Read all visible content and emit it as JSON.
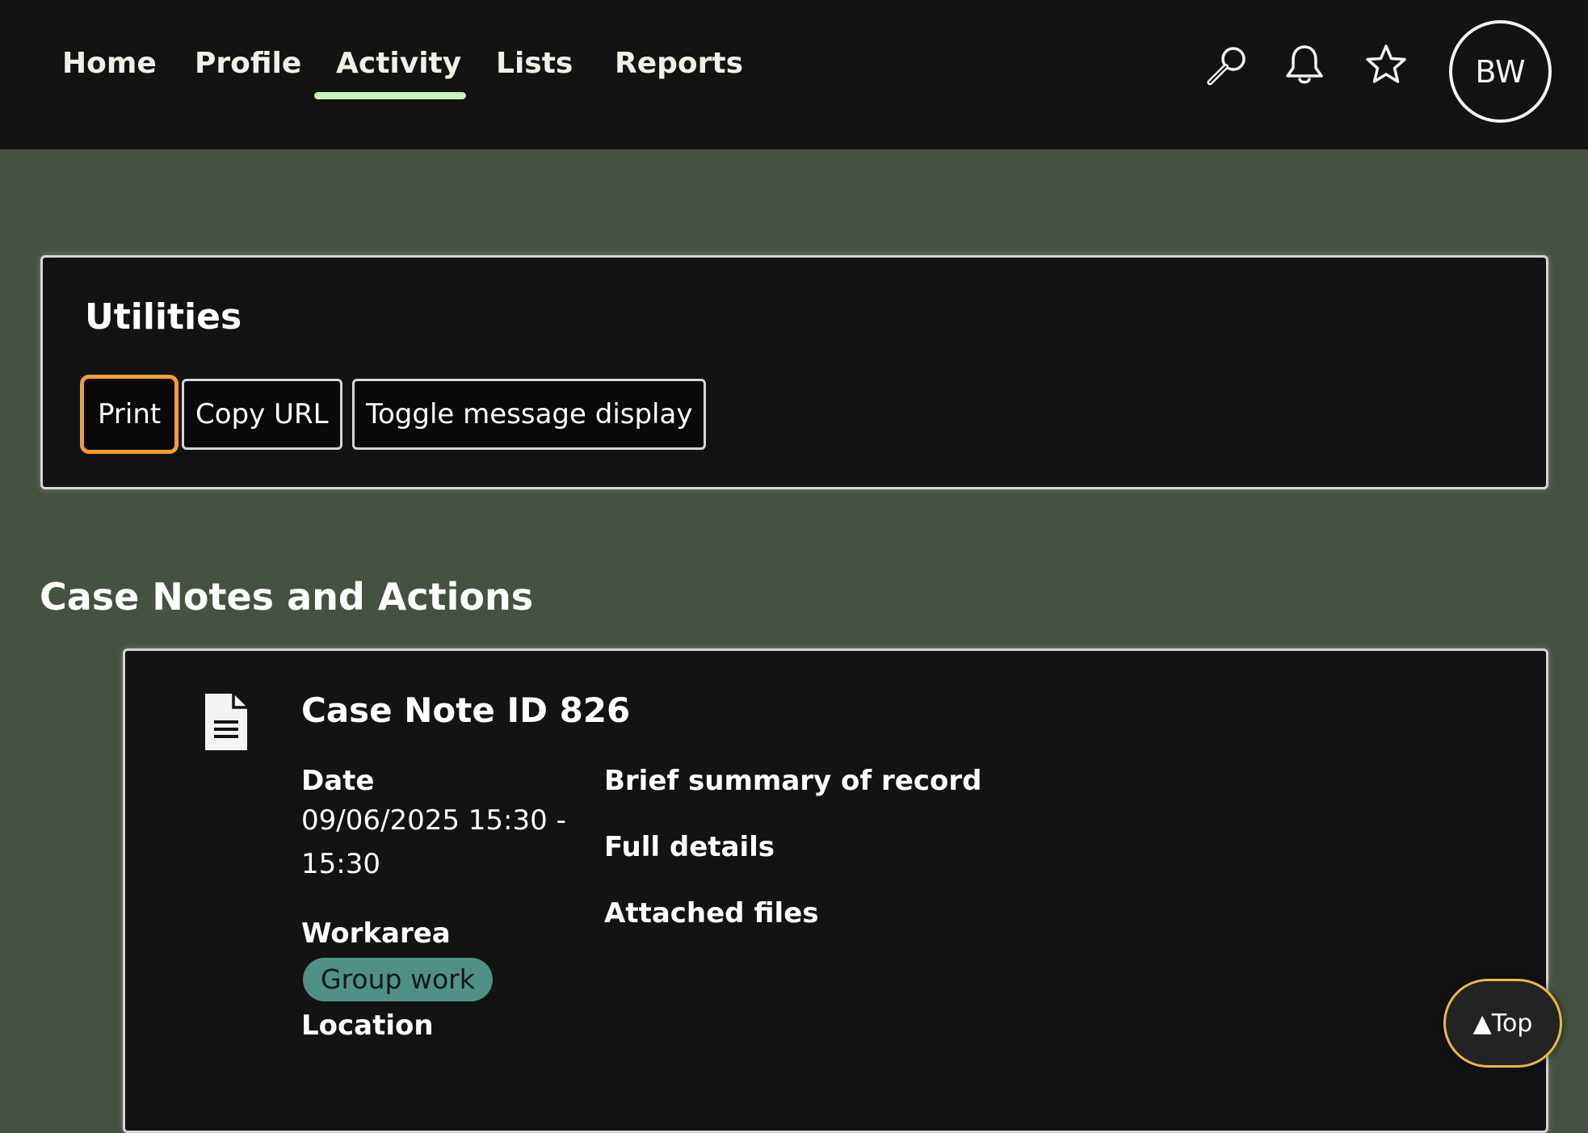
{
  "nav": {
    "items": [
      {
        "label": "Home"
      },
      {
        "label": "Profile"
      },
      {
        "label": "Activity",
        "active": true
      },
      {
        "label": "Lists"
      },
      {
        "label": "Reports"
      }
    ],
    "icons": [
      "search-icon",
      "bell-icon",
      "star-icon"
    ],
    "avatar_initials": "BW"
  },
  "utilities": {
    "title": "Utilities",
    "buttons": [
      {
        "label": "Print",
        "focused": true
      },
      {
        "label": "Copy URL"
      },
      {
        "label": "Toggle message display"
      }
    ]
  },
  "section": {
    "title": "Case Notes and Actions"
  },
  "case_note": {
    "icon": "document-icon",
    "title": "Case Note ID 826",
    "date_label": "Date",
    "date_value": "09/06/2025 15:30 - 15:30",
    "workarea_label": "Workarea",
    "workarea_tag": "Group work",
    "location_label": "Location",
    "summary_label": "Brief summary of record",
    "details_label": "Full details",
    "files_label": "Attached files"
  },
  "back_to_top": {
    "label": "▲Top"
  },
  "colors": {
    "page_bg": "#465241",
    "bar_bg": "#131313",
    "active_underline": "#c9f2b8",
    "focus_ring": "#f59d35",
    "tag_bg": "#4f9187",
    "top_button_border": "#e8b94a"
  }
}
